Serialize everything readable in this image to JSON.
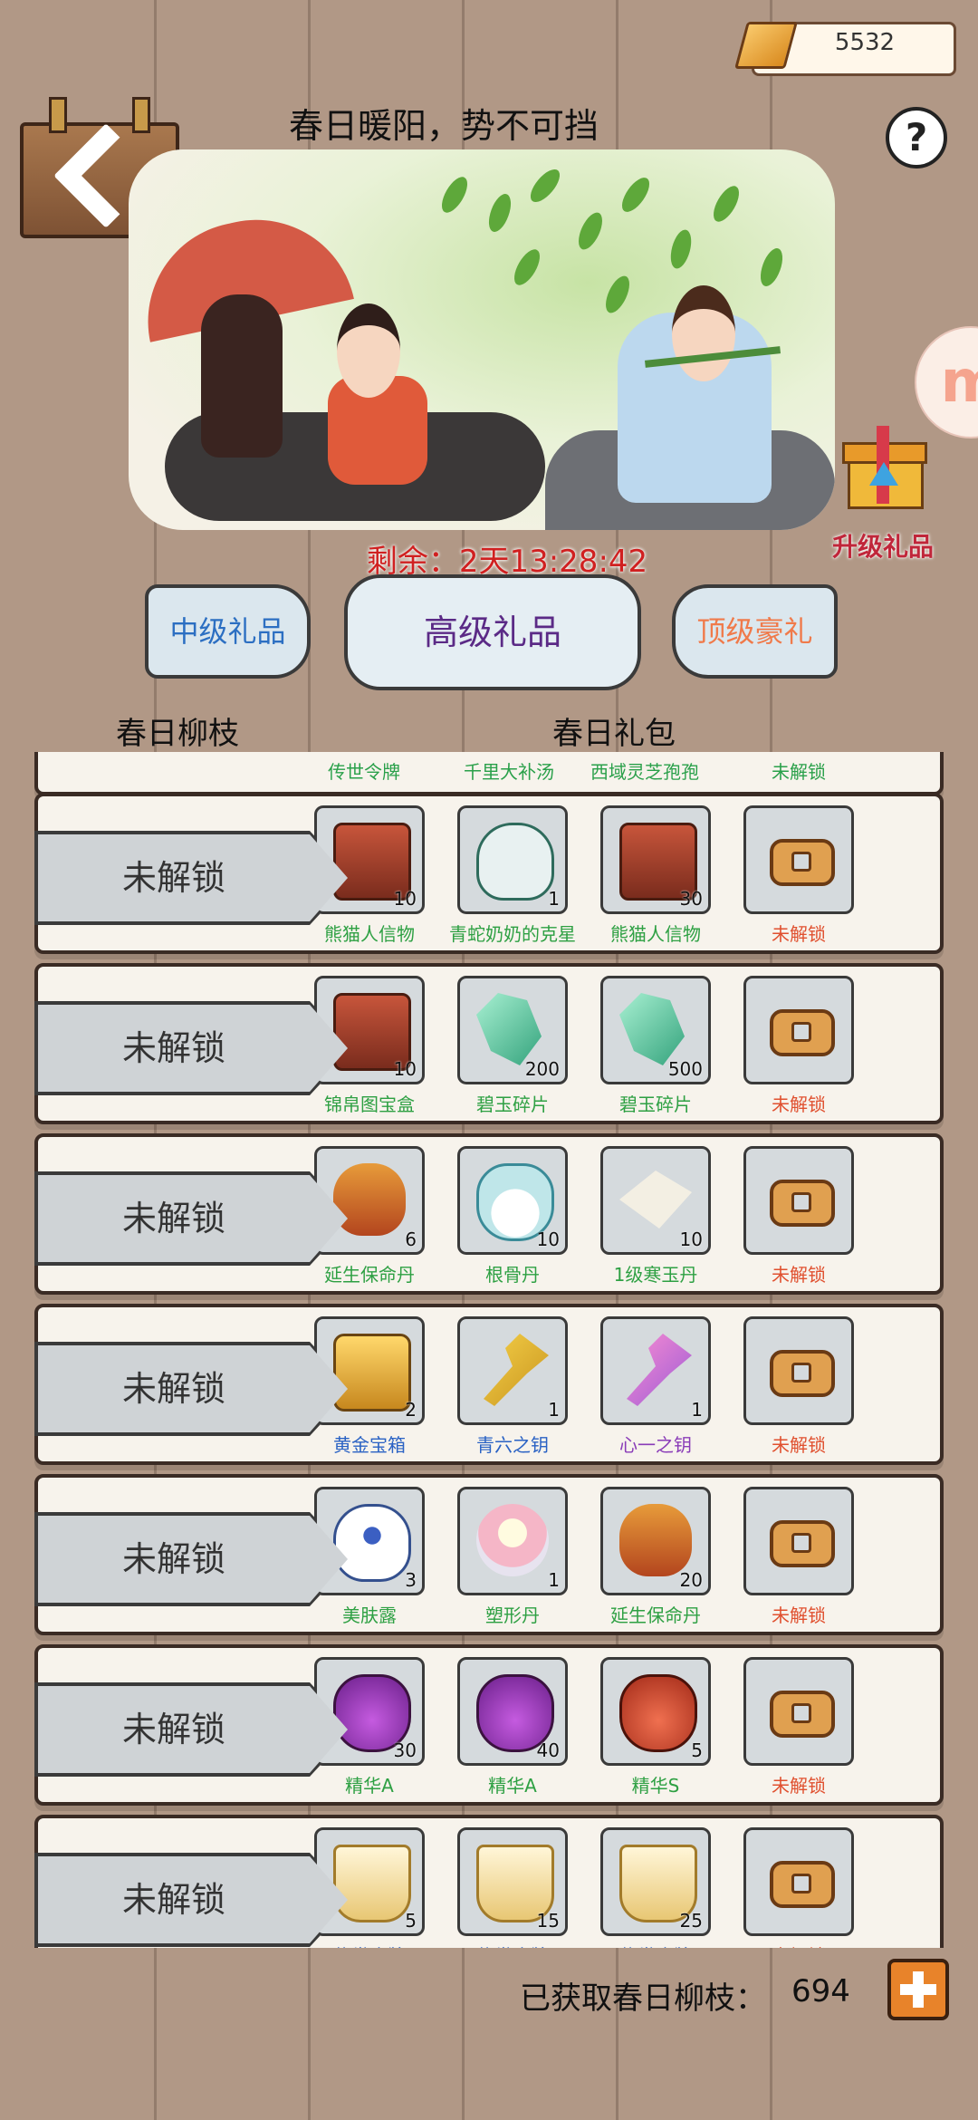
{
  "currency": {
    "gold": "5532",
    "ingot_icon": "gold-ingot-icon"
  },
  "header": {
    "title": "春日暖阳，势不可挡",
    "help": "?"
  },
  "timer": "剩余：2天13:28:42",
  "side": {
    "logo_letter": "m",
    "gift_label": "升级礼品"
  },
  "tabs": {
    "mid": "中级礼品",
    "high": "高级礼品",
    "top": "顶级豪礼"
  },
  "columns": {
    "left": "春日柳枝",
    "right": "春日礼包"
  },
  "partial_row": {
    "names": [
      "传世令牌",
      "千里大补汤",
      "西域灵芝孢孢",
      "未解锁"
    ]
  },
  "rows": [
    {
      "status": "未解锁",
      "items": [
        {
          "name": "熊猫人信物",
          "count": "10",
          "color": "green",
          "icon": "chest"
        },
        {
          "name": "青蛇奶奶的克星",
          "count": "1",
          "color": "green",
          "icon": "bottle"
        },
        {
          "name": "熊猫人信物",
          "count": "30",
          "color": "green",
          "icon": "chest"
        },
        {
          "name": "未解锁",
          "count": "",
          "color": "red",
          "icon": "lock"
        }
      ]
    },
    {
      "status": "未解锁",
      "items": [
        {
          "name": "锦帛图宝盒",
          "count": "10",
          "color": "green",
          "icon": "chest"
        },
        {
          "name": "碧玉碎片",
          "count": "200",
          "color": "green",
          "icon": "jade"
        },
        {
          "name": "碧玉碎片",
          "count": "500",
          "color": "green",
          "icon": "jade"
        },
        {
          "name": "未解锁",
          "count": "",
          "color": "red",
          "icon": "lock"
        }
      ]
    },
    {
      "status": "未解锁",
      "items": [
        {
          "name": "延生保命丹",
          "count": "6",
          "color": "green",
          "icon": "gourd"
        },
        {
          "name": "根骨丹",
          "count": "10",
          "color": "green",
          "icon": "vase"
        },
        {
          "name": "1级寒玉丹",
          "count": "10",
          "color": "green",
          "icon": "pills"
        },
        {
          "name": "未解锁",
          "count": "",
          "color": "red",
          "icon": "lock"
        }
      ]
    },
    {
      "status": "未解锁",
      "items": [
        {
          "name": "黄金宝箱",
          "count": "2",
          "color": "blue",
          "icon": "gold-chest"
        },
        {
          "name": "青六之钥",
          "count": "1",
          "color": "blue",
          "icon": "key-blue"
        },
        {
          "name": "心一之钥",
          "count": "1",
          "color": "purple",
          "icon": "key-purple"
        },
        {
          "name": "未解锁",
          "count": "",
          "color": "red",
          "icon": "lock"
        }
      ]
    },
    {
      "status": "未解锁",
      "items": [
        {
          "name": "美肤露",
          "count": "3",
          "color": "green",
          "icon": "porcelain"
        },
        {
          "name": "塑形丹",
          "count": "1",
          "color": "green",
          "icon": "pearl"
        },
        {
          "name": "延生保命丹",
          "count": "20",
          "color": "green",
          "icon": "gourd"
        },
        {
          "name": "未解锁",
          "count": "",
          "color": "red",
          "icon": "lock"
        }
      ]
    },
    {
      "status": "未解锁",
      "items": [
        {
          "name": "精华A",
          "count": "30",
          "color": "green",
          "icon": "pot-purple"
        },
        {
          "name": "精华A",
          "count": "40",
          "color": "green",
          "icon": "pot-purple"
        },
        {
          "name": "精华S",
          "count": "5",
          "color": "green",
          "icon": "pot-red"
        },
        {
          "name": "未解锁",
          "count": "",
          "color": "red",
          "icon": "lock"
        }
      ]
    },
    {
      "status": "未解锁",
      "items": [
        {
          "name": "传世令牌",
          "count": "5",
          "color": "blue",
          "icon": "token"
        },
        {
          "name": "传世令牌",
          "count": "15",
          "color": "blue",
          "icon": "token"
        },
        {
          "name": "传世令牌",
          "count": "25",
          "color": "blue",
          "icon": "token"
        },
        {
          "name": "未解锁",
          "count": "",
          "color": "red",
          "icon": "lock"
        }
      ]
    }
  ],
  "footer": {
    "label": "已获取春日柳枝：",
    "value": "694"
  }
}
